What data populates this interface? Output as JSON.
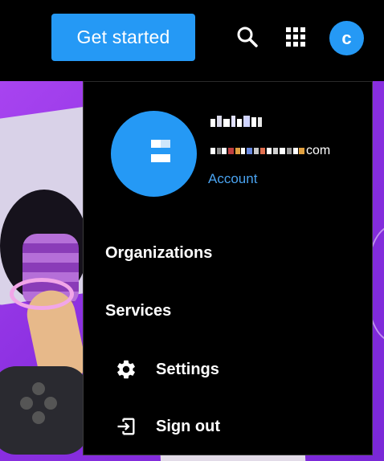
{
  "header": {
    "get_started_label": "Get started",
    "search_icon": "search-icon",
    "apps_icon": "apps-grid-icon",
    "avatar_initial": "c"
  },
  "account_menu": {
    "user_name": "",
    "email_suffix": "com",
    "account_link": "Account",
    "items": [
      {
        "label": "Organizations"
      },
      {
        "label": "Services"
      },
      {
        "label": "Settings",
        "icon": "gear-icon"
      },
      {
        "label": "Sign out",
        "icon": "sign-out-icon"
      }
    ]
  },
  "colors": {
    "accent": "#2599f5",
    "link": "#4aa3f0",
    "background": "#000000",
    "art_purple": "#8a2fe0"
  }
}
